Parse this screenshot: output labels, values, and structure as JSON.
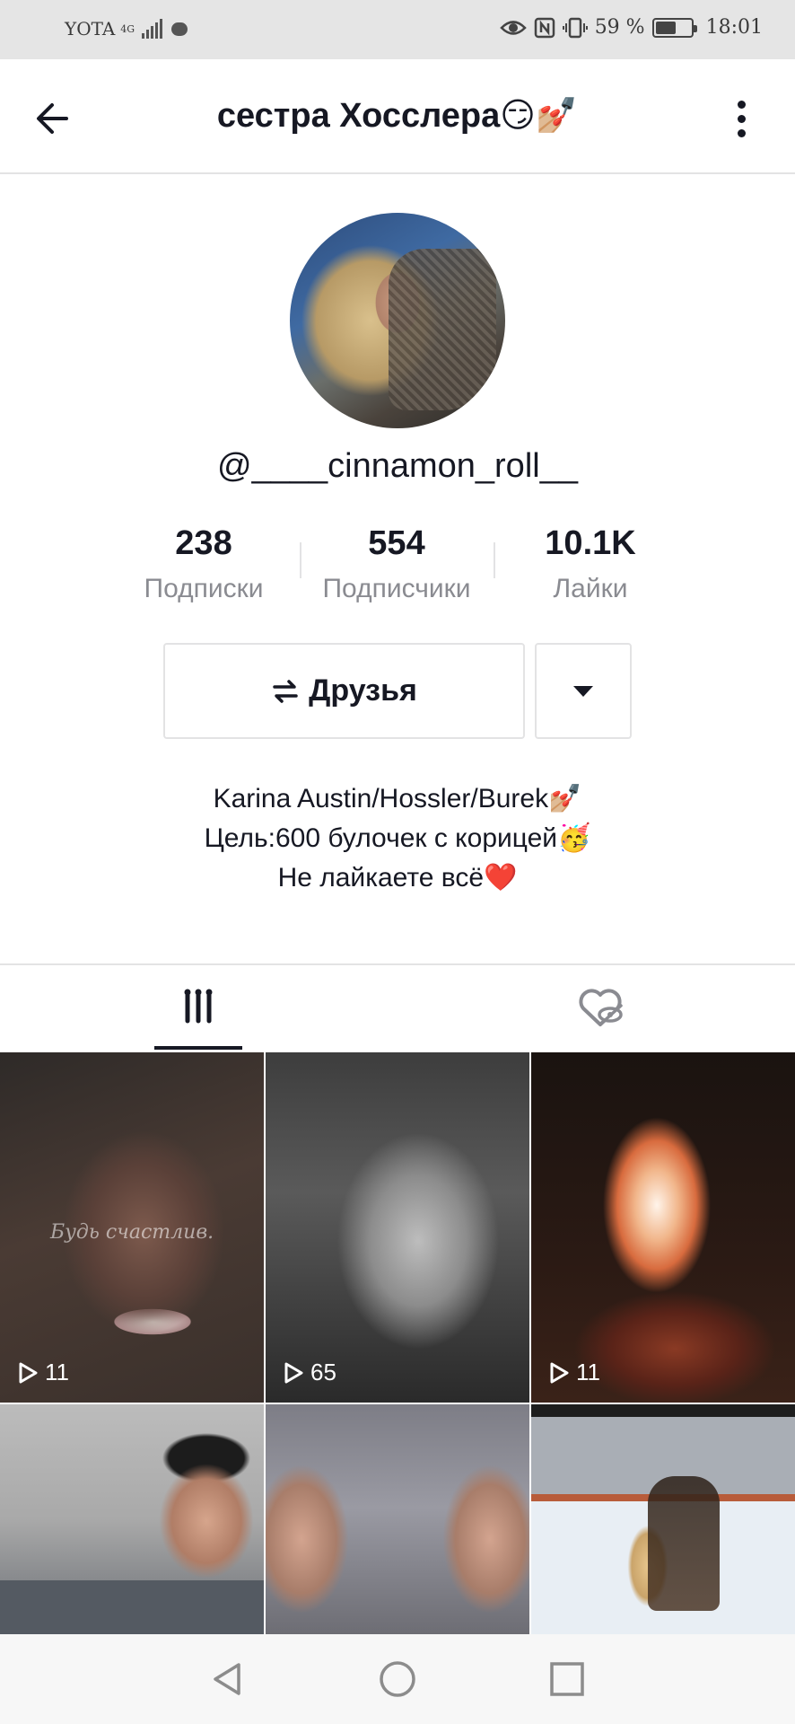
{
  "status_bar": {
    "carrier": "YOTA",
    "network": "4G",
    "battery": "59 %",
    "battery_level": 0.59,
    "time": "18:01",
    "icons": [
      "eye-icon",
      "nfc-icon",
      "vibrate-icon",
      "battery-icon"
    ]
  },
  "header": {
    "title": "сестра Хосслера😏💅🏼",
    "back_icon": "arrow-left-icon",
    "menu_icon": "more-vertical-icon"
  },
  "profile": {
    "username": "@____cinnamon_roll__",
    "stats": [
      {
        "value": "238",
        "label": "Подписки"
      },
      {
        "value": "554",
        "label": "Подписчики"
      },
      {
        "value": "10.1K",
        "label": "Лайки"
      }
    ],
    "friends_button": "Друзья",
    "bio": [
      "Karina Austin/Hossler/Burek💅🏼",
      "Цель:600 булочек с корицей🥳",
      "Не лайкаете всё❤️"
    ]
  },
  "tabs": {
    "videos_icon": "grid-icon",
    "liked_icon": "hidden-heart-icon"
  },
  "videos": [
    {
      "views": "11",
      "overlay_text": "Будь счастлив."
    },
    {
      "views": "65"
    },
    {
      "views": "11"
    },
    {},
    {},
    {}
  ],
  "nav": {
    "icons": [
      "back-triangle-icon",
      "home-circle-icon",
      "recents-square-icon"
    ]
  },
  "colors": {
    "primary_text": "#161823",
    "secondary_text": "#8a8b91",
    "divider": "#e3e3e4",
    "status_bar_bg": "#e5e5e5"
  }
}
